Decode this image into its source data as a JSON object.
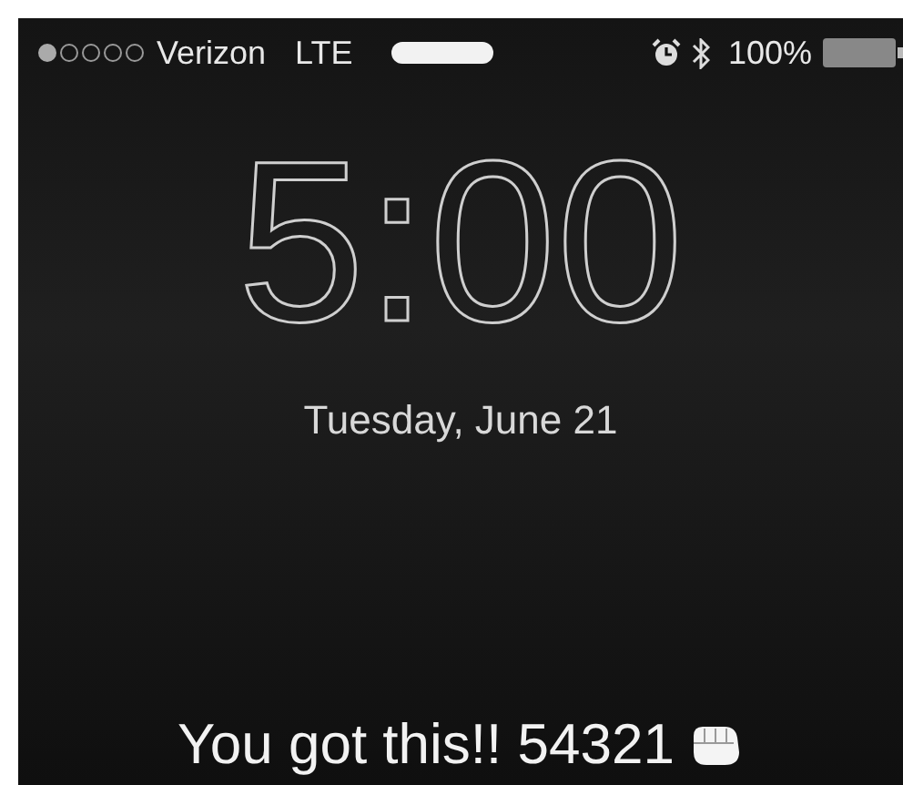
{
  "status_bar": {
    "carrier": "Verizon",
    "network": "LTE",
    "battery": "100%"
  },
  "lock_screen": {
    "time": "5:00",
    "date": "Tuesday, June 21",
    "message": "You got this!! 54321"
  }
}
